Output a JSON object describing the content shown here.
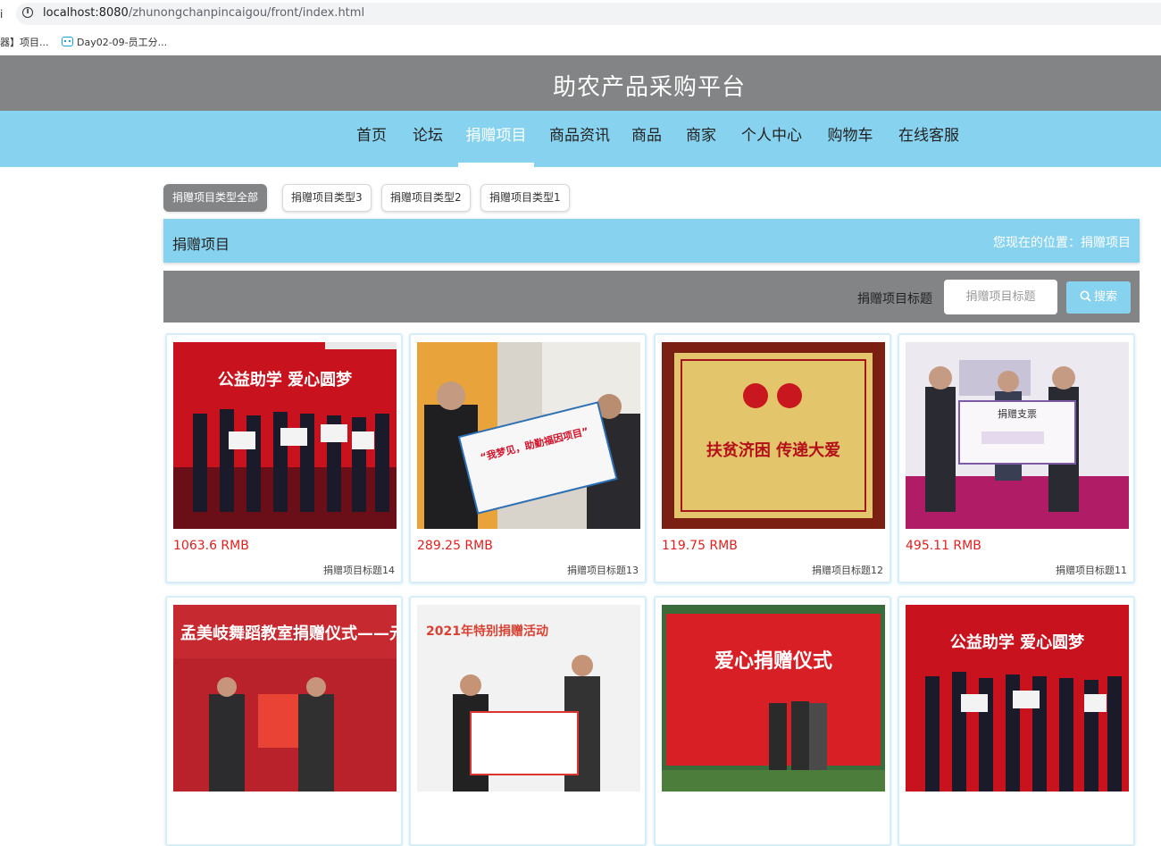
{
  "browser": {
    "left_mark": "i",
    "url_host": "localhost:8080",
    "url_path": "/zhunongchanpincaigou/front/index.html",
    "bookmarks": [
      "器】项目...",
      "Day02-09-员工分..."
    ]
  },
  "header": {
    "title": "助农产品采购平台"
  },
  "nav": {
    "items": [
      "首页",
      "论坛",
      "捐赠项目",
      "商品资讯",
      "商品",
      "商家",
      "个人中心",
      "购物车",
      "在线客服"
    ],
    "active": "捐赠项目"
  },
  "filters": [
    "捐赠项目类型全部",
    "捐赠项目类型3",
    "捐赠项目类型2",
    "捐赠项目类型1"
  ],
  "page": {
    "title": "捐赠项目",
    "location": "您现在的位置：捐赠项目"
  },
  "search": {
    "label": "捐赠项目标题",
    "placeholder": "捐赠项目标题",
    "button": "搜索"
  },
  "cards": [
    {
      "price": "1063.6 RMB",
      "title": "捐赠项目标题14",
      "img_text": "公益助学 爱心圆梦"
    },
    {
      "price": "289.25 RMB",
      "title": "捐赠项目标题13",
      "img_text": "“我梦见，助勤福因项目”"
    },
    {
      "price": "119.75 RMB",
      "title": "捐赠项目标题12",
      "img_text": "扶贫济困 传递大爱"
    },
    {
      "price": "495.11 RMB",
      "title": "捐赠项目标题11",
      "img_text": "捐赠支票"
    },
    {
      "price": "",
      "title": "",
      "img_text": "孟美岐舞蹈教室捐赠仪式——元过小"
    },
    {
      "price": "",
      "title": "",
      "img_text": "2021年特别捐赠活动"
    },
    {
      "price": "",
      "title": "",
      "img_text": "爱心捐赠仪式"
    },
    {
      "price": "",
      "title": "",
      "img_text": "公益助学 爱心圆梦"
    }
  ],
  "colors": {
    "header": "#828485",
    "nav": "#87d3ef",
    "price": "#e02020"
  }
}
